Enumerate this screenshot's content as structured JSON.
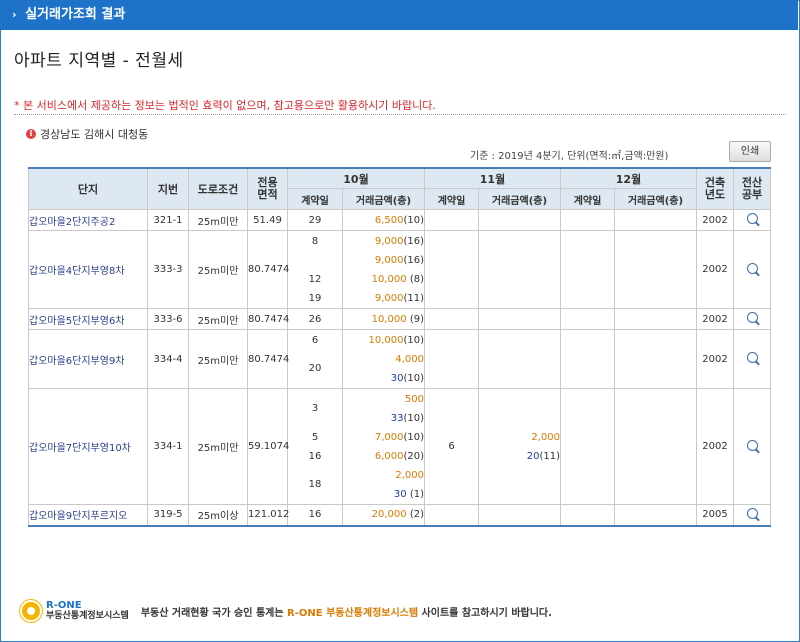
{
  "titlebar": {
    "arrow": "›",
    "label": "실거래가조회 결과"
  },
  "page_title": "아파트 지역별 - 전월세",
  "notice": "* 본 서비스에서 제공하는 정보는 법적인 효력이 없으며, 참고용으로만 활용하시기 바랍니다.",
  "location": "경상남도 김해시 대청동",
  "basis": "기준 : 2019년 4분기, 단위(면적:㎡,금액:만원)",
  "print_label": "인쇄",
  "headers": {
    "complex": "단지",
    "lot": "지번",
    "road": "도로조건",
    "area": "전용\n면적",
    "oct": "10월",
    "nov": "11월",
    "dec": "12월",
    "built": "건축\n년도",
    "ledger": "전산\n공부",
    "contract_day": "계약일",
    "deal_amount": "거래금액(층)"
  },
  "rows": [
    {
      "name": "갑오마을2단지주공2",
      "lot": "321-1",
      "road": "25m미만",
      "area": "51.49",
      "built": "2002",
      "oct": [
        {
          "day": "29",
          "amt": "6,500",
          "sub": "",
          "floor": "(10)"
        }
      ],
      "nov": [],
      "dec": []
    },
    {
      "name": "갑오마을4단지부영8차",
      "lot": "333-3",
      "road": "25m미만",
      "area": "80.7474",
      "built": "2002",
      "oct": [
        {
          "day": "8",
          "amt": "9,000",
          "sub": "",
          "floor": "(16)"
        },
        {
          "day": "",
          "amt": "9,000",
          "sub": "",
          "floor": "(16)"
        },
        {
          "day": "12",
          "amt": "10,000",
          "sub": "",
          "floor": " (8)"
        },
        {
          "day": "19",
          "amt": "9,000",
          "sub": "",
          "floor": "(11)"
        }
      ],
      "nov": [],
      "dec": []
    },
    {
      "name": "갑오마을5단지부영6차",
      "lot": "333-6",
      "road": "25m미만",
      "area": "80.7474",
      "built": "2002",
      "oct": [
        {
          "day": "26",
          "amt": "10,000",
          "sub": "",
          "floor": " (9)"
        }
      ],
      "nov": [],
      "dec": []
    },
    {
      "name": "갑오마을6단지부영9차",
      "lot": "334-4",
      "road": "25m미만",
      "area": "80.7474",
      "built": "2002",
      "oct": [
        {
          "day": "6",
          "amt": "10,000",
          "sub": "",
          "floor": "(10)"
        },
        {
          "day": "20",
          "amt": "4,000",
          "sub": "30",
          "floor": "(10)"
        }
      ],
      "nov": [],
      "dec": []
    },
    {
      "name": "갑오마을7단지부영10차",
      "lot": "334-1",
      "road": "25m미만",
      "area": "59.1074",
      "built": "2002",
      "oct": [
        {
          "day": "3",
          "amt": "500",
          "sub": "33",
          "floor": "(10)"
        },
        {
          "day": "5",
          "amt": "7,000",
          "sub": "",
          "floor": "(10)"
        },
        {
          "day": "16",
          "amt": "6,000",
          "sub": "",
          "floor": "(20)"
        },
        {
          "day": "18",
          "amt": "2,000",
          "sub": "30",
          "floor": " (1)"
        }
      ],
      "nov": [
        {
          "day": "6",
          "amt": "2,000",
          "sub": "20",
          "floor": "(11)"
        }
      ],
      "dec": []
    },
    {
      "name": "갑오마을9단지푸르지오",
      "lot": "319-5",
      "road": "25m이상",
      "area": "121.012",
      "built": "2005",
      "oct": [
        {
          "day": "16",
          "amt": "20,000",
          "sub": "",
          "floor": " (2)"
        }
      ],
      "nov": [],
      "dec": []
    }
  ],
  "footer": {
    "logo_top": "R-ONE",
    "logo_bottom": "부동산통계정보시스템",
    "msg_before": "부동산 거래현황 국가 승인 통계는 ",
    "msg_link": "R-ONE 부동산통계정보시스템",
    "msg_after": " 사이트를 참고하시기 바랍니다."
  },
  "colors": {
    "titlebar": "#1e73c8",
    "header_bg": "#dde8f3",
    "deposit": "#d97a00",
    "monthly": "#1d3fa3",
    "notice": "#d8262a"
  }
}
